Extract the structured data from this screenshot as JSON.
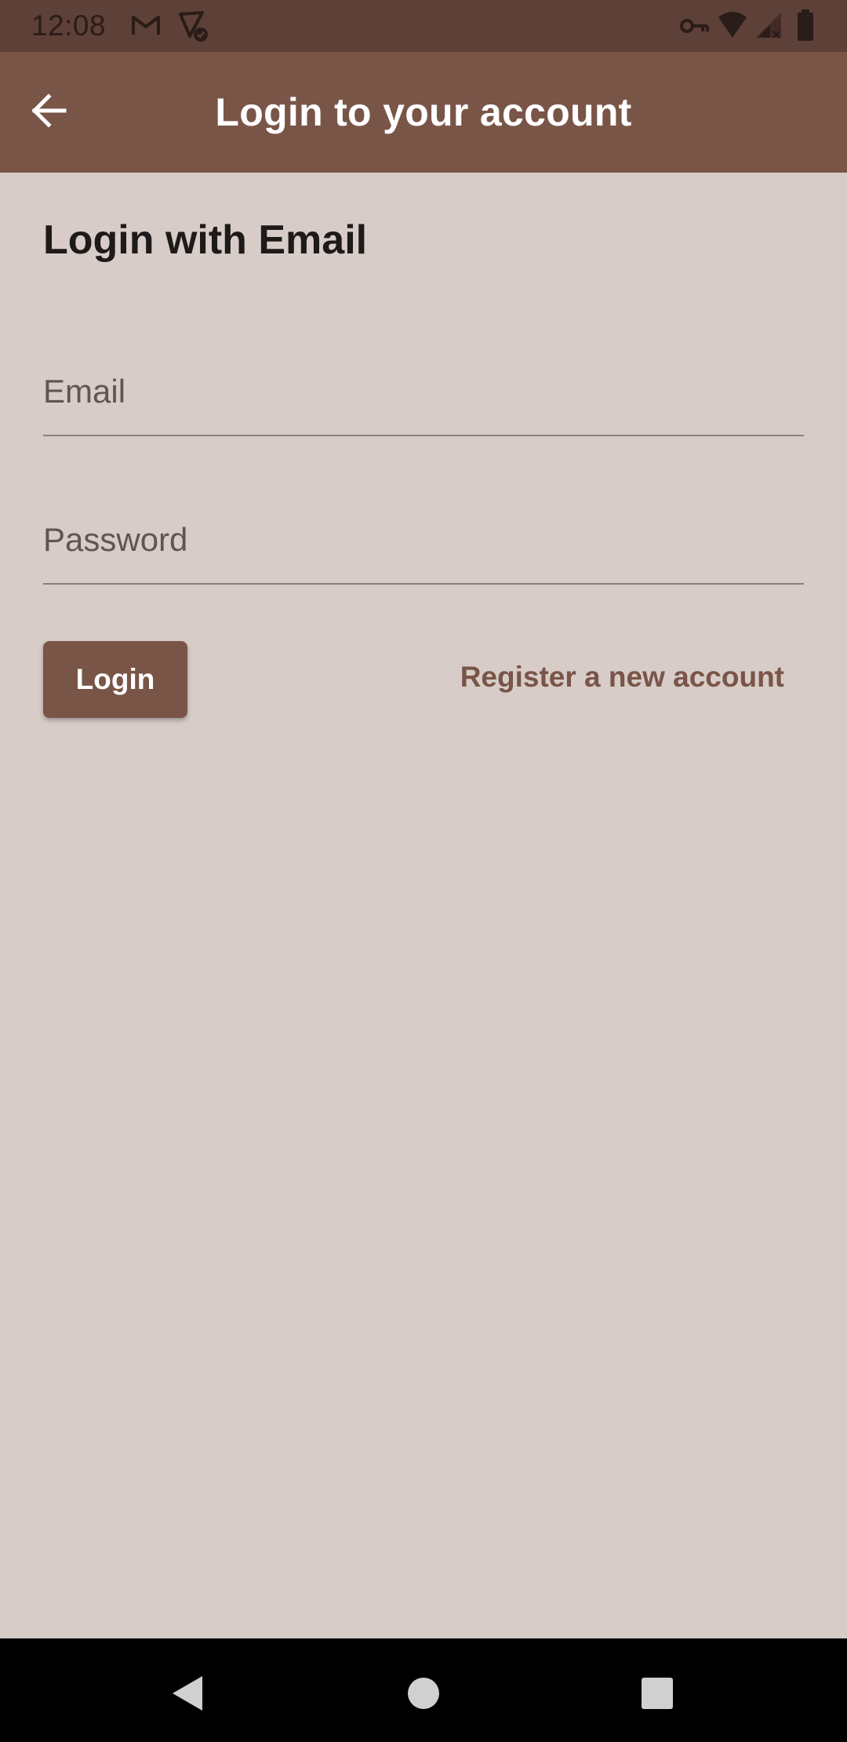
{
  "status_bar": {
    "time": "12:08",
    "icons": [
      "gmail-icon",
      "location-check-icon",
      "vpn-key-icon",
      "wifi-icon",
      "signal-icon",
      "battery-icon"
    ]
  },
  "app_bar": {
    "title": "Login to your account",
    "back_icon": "arrow-back-icon"
  },
  "main": {
    "section_title": "Login with Email",
    "email": {
      "placeholder": "Email",
      "value": ""
    },
    "password": {
      "placeholder": "Password",
      "value": ""
    },
    "login_label": "Login",
    "register_label": "Register a new account"
  },
  "nav_bar": {
    "icons": [
      "back-triangle-icon",
      "home-circle-icon",
      "recents-square-icon"
    ]
  },
  "colors": {
    "primary": "#795548",
    "primary_dark": "#5d4037",
    "background": "#d7ccc8",
    "text_dark": "#1e1a19"
  }
}
